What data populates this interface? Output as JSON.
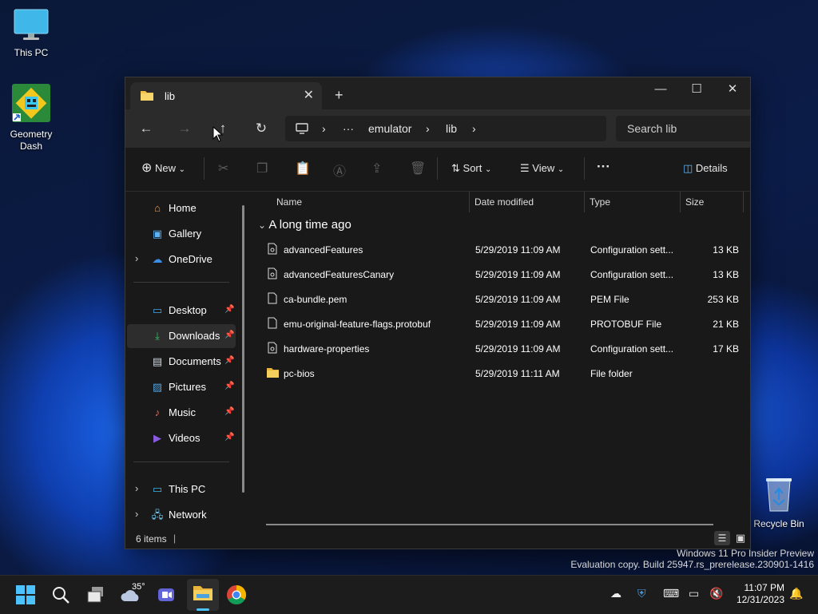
{
  "desktop": {
    "icons": [
      {
        "label": "This PC"
      },
      {
        "label": "Geometry\nDash"
      },
      {
        "label": "Recycle Bin"
      }
    ]
  },
  "window": {
    "tab_title": "lib",
    "address": {
      "crumbs": [
        "emulator",
        "lib"
      ],
      "more": "···"
    },
    "search": {
      "placeholder": "Search lib"
    },
    "cmd": {
      "new": "New",
      "sort": "Sort",
      "view": "View",
      "more": "···",
      "details": "Details"
    },
    "sidebar": {
      "items": [
        {
          "label": "Home"
        },
        {
          "label": "Gallery"
        },
        {
          "label": "OneDrive"
        },
        {
          "label": "Desktop"
        },
        {
          "label": "Downloads"
        },
        {
          "label": "Documents"
        },
        {
          "label": "Pictures"
        },
        {
          "label": "Music"
        },
        {
          "label": "Videos"
        },
        {
          "label": "This PC"
        },
        {
          "label": "Network"
        }
      ]
    },
    "columns": {
      "name": "Name",
      "date": "Date modified",
      "type": "Type",
      "size": "Size"
    },
    "group": "A long time ago",
    "files": [
      {
        "name": "advancedFeatures",
        "date": "5/29/2019 11:09 AM",
        "type": "Configuration sett...",
        "size": "13 KB"
      },
      {
        "name": "advancedFeaturesCanary",
        "date": "5/29/2019 11:09 AM",
        "type": "Configuration sett...",
        "size": "13 KB"
      },
      {
        "name": "ca-bundle.pem",
        "date": "5/29/2019 11:09 AM",
        "type": "PEM File",
        "size": "253 KB"
      },
      {
        "name": "emu-original-feature-flags.protobuf",
        "date": "5/29/2019 11:09 AM",
        "type": "PROTOBUF File",
        "size": "21 KB"
      },
      {
        "name": "hardware-properties",
        "date": "5/29/2019 11:09 AM",
        "type": "Configuration sett...",
        "size": "17 KB"
      },
      {
        "name": "pc-bios",
        "date": "5/29/2019 11:11 AM",
        "type": "File folder",
        "size": ""
      }
    ],
    "status": "6 items"
  },
  "watermark": {
    "line1": "Windows 11 Pro Insider Preview",
    "line2": "Evaluation copy. Build 25947.rs_prerelease.230901-1416"
  },
  "taskbar": {
    "weather": "35°",
    "time": "11:07 PM",
    "date": "12/31/2023"
  },
  "colors": {
    "accent": "#0078d4",
    "folder": "#f2c24b",
    "taskbar": "#1c1c1c",
    "window": "#191919"
  }
}
